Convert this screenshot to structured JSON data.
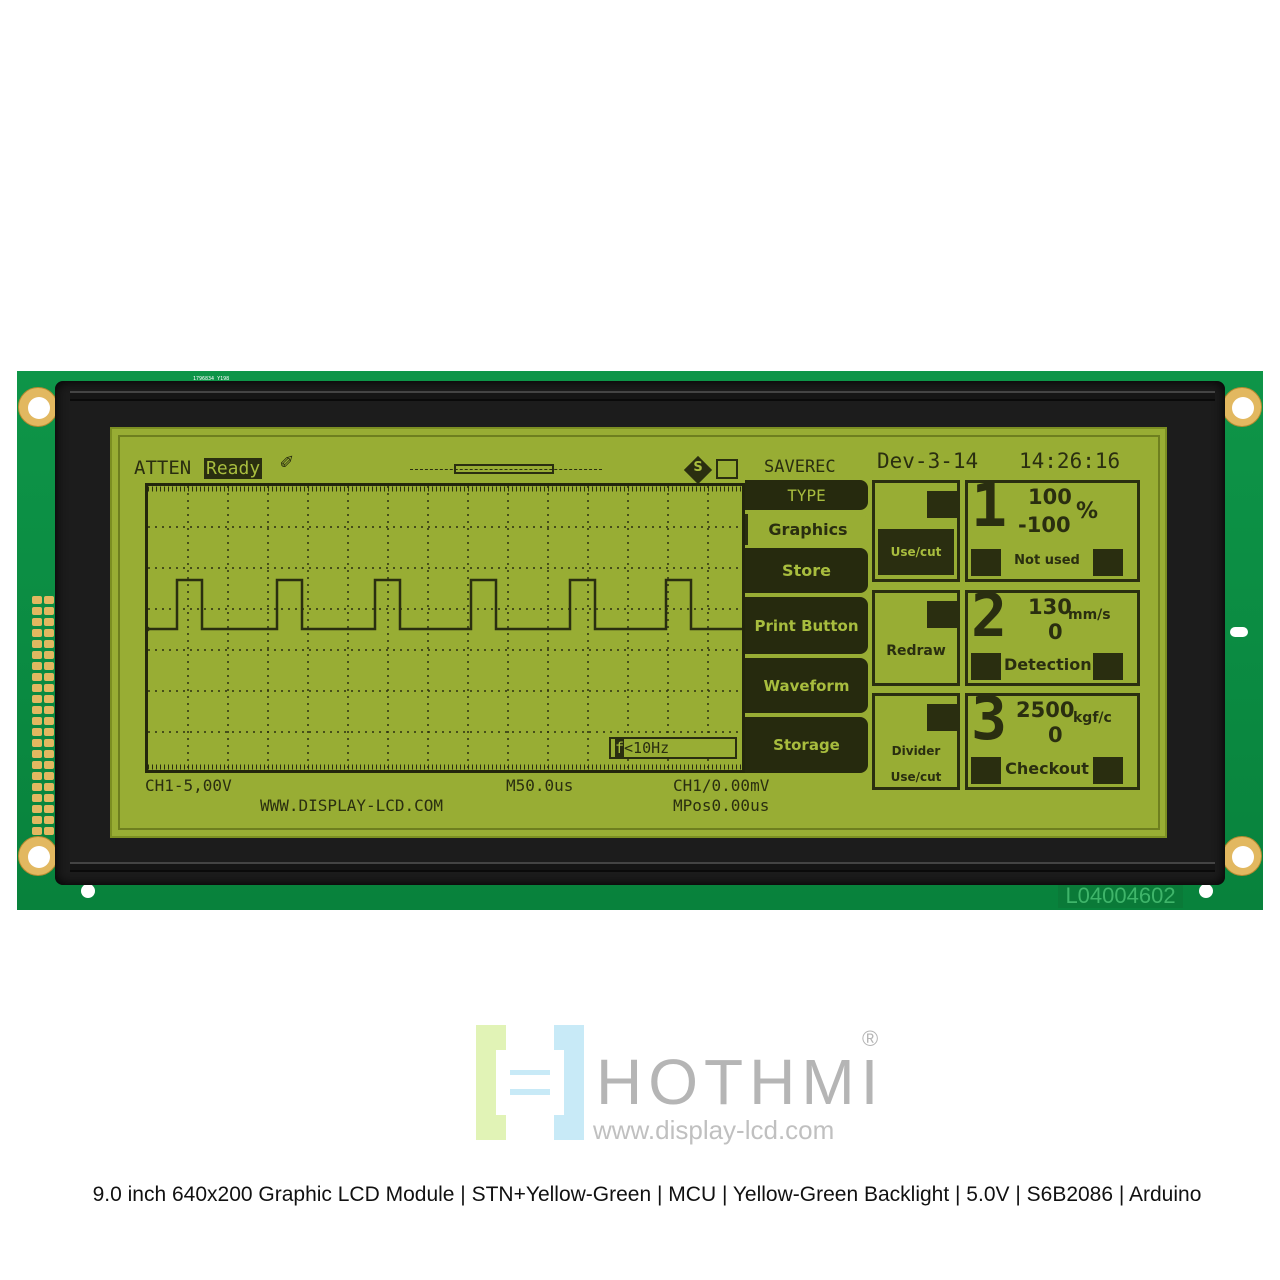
{
  "pcb": {
    "top_code": "1796834_Y198",
    "serial": "L04004602",
    "color": "#0b8a42"
  },
  "lcd": {
    "bg_color": "#98ad34",
    "ink_color": "#2a2e10",
    "status": {
      "atten": "ATTEN",
      "ready": "Ready",
      "saverec": "SAVEREC",
      "date": "Dev-3-14",
      "time": "14:26:16",
      "s_badge": "S"
    },
    "menu": [
      {
        "label": "TYPE"
      },
      {
        "label": "Graphics"
      },
      {
        "label": "Store"
      },
      {
        "label": "Print Button"
      },
      {
        "label": "Waveform"
      },
      {
        "label": "Storage"
      }
    ],
    "freq": "<10Hz",
    "freq_icon": "f",
    "footer": {
      "ch_scale": "CH1-5,00V",
      "timebase": "M50.0us",
      "trigger": "CH1/0.00mV",
      "url": "WWW.DISPLAY-LCD.COM",
      "mpos": "MPos0.00us"
    },
    "panels": [
      {
        "left_label": "Use/cut",
        "left_label2": "",
        "number": "1",
        "max": "100",
        "min": "-100",
        "unit": "%",
        "status": "Not used"
      },
      {
        "left_label": "Redraw",
        "left_label2": "",
        "number": "2",
        "max": "130",
        "min": "0",
        "unit": "mm/s",
        "status": "Detection"
      },
      {
        "left_label": "Divider",
        "left_label2": "Use/cut",
        "number": "3",
        "max": "2500",
        "min": "0",
        "unit": "kgf/c",
        "status": "Checkout"
      }
    ]
  },
  "brand": {
    "name": "HOTHMI",
    "registered": "®",
    "url": "www.display-lcd.com"
  },
  "caption": "9.0 inch 640x200 Graphic LCD Module | STN+Yellow-Green | MCU | Yellow-Green Backlight | 5.0V | S6B2086 | Arduino"
}
